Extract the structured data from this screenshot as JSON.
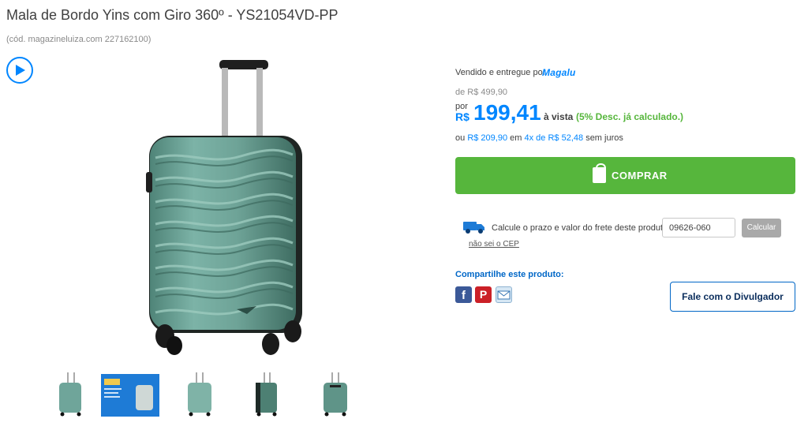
{
  "product": {
    "title": "Mala de Bordo Yins com Giro 360º - YS21054VD-PP",
    "code": "(cód. magazineluiza.com 227162100)"
  },
  "seller": {
    "label": "Vendido e entregue por",
    "brand": "Magalu"
  },
  "pricing": {
    "old_price": "de R$ 499,90",
    "por_label": "por",
    "currency": "R$",
    "price": "199,41",
    "avista": "à vista",
    "discount": "(5% Desc. já calculado.)",
    "installment_prefix": "ou",
    "installment_total": "R$ 209,90",
    "installment_mid": "em",
    "installment_count": "4x de",
    "installment_value": "R$ 52,48",
    "installment_suffix": "sem juros"
  },
  "buy": {
    "label": "COMPRAR"
  },
  "freight": {
    "label": "Calcule o prazo e valor do frete deste produto:",
    "cep_value": "09626-060",
    "calc_label": "Calcular",
    "no_cep_link": "não sei o CEP"
  },
  "share": {
    "label": "Compartilhe este produto:",
    "facebook_glyph": "f",
    "pinterest_glyph": "P"
  },
  "contact": {
    "label": "Fale com o Divulgador"
  },
  "icons": {
    "play": "play-icon",
    "bag": "shopping-bag-icon",
    "truck": "truck-icon",
    "facebook": "facebook-icon",
    "pinterest": "pinterest-icon",
    "email": "email-icon"
  },
  "colors": {
    "accent_blue": "#0086ff",
    "buy_green": "#56b63c",
    "suitcase_green": "#6fa59a"
  }
}
